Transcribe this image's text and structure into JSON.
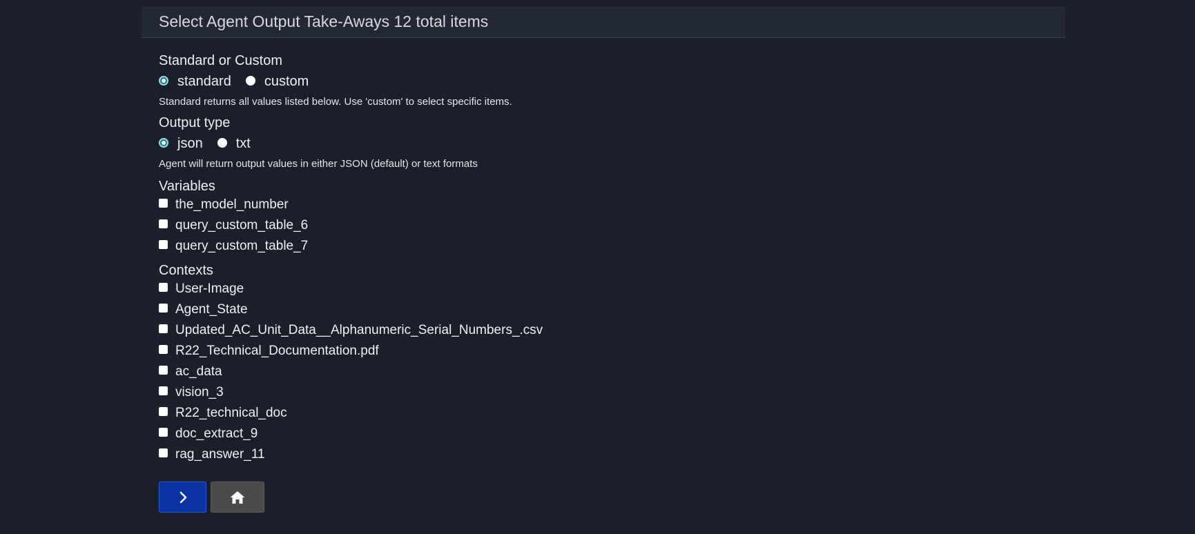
{
  "header": {
    "title": "Select Agent Output Take-Aways 12 total items"
  },
  "mode": {
    "label": "Standard or Custom",
    "options": [
      {
        "label": "standard",
        "checked": true
      },
      {
        "label": "custom",
        "checked": false
      }
    ],
    "help": "Standard returns all values listed below. Use 'custom' to select specific items."
  },
  "output_type": {
    "label": "Output type",
    "options": [
      {
        "label": "json",
        "checked": true
      },
      {
        "label": "txt",
        "checked": false
      }
    ],
    "help": "Agent will return output values in either JSON (default) or text formats"
  },
  "variables": {
    "label": "Variables",
    "items": [
      {
        "label": "the_model_number",
        "checked": false
      },
      {
        "label": "query_custom_table_6",
        "checked": false
      },
      {
        "label": "query_custom_table_7",
        "checked": false
      }
    ]
  },
  "contexts": {
    "label": "Contexts",
    "items": [
      {
        "label": "User-Image",
        "checked": false
      },
      {
        "label": "Agent_State",
        "checked": false
      },
      {
        "label": "Updated_AC_Unit_Data__Alphanumeric_Serial_Numbers_.csv",
        "checked": false
      },
      {
        "label": "R22_Technical_Documentation.pdf",
        "checked": false
      },
      {
        "label": "ac_data",
        "checked": false
      },
      {
        "label": "vision_3",
        "checked": false
      },
      {
        "label": "R22_technical_doc",
        "checked": false
      },
      {
        "label": "doc_extract_9",
        "checked": false
      },
      {
        "label": "rag_answer_11",
        "checked": false
      }
    ]
  },
  "buttons": {
    "next_icon": "chevron-right-icon",
    "home_icon": "home-icon"
  },
  "colors": {
    "background": "#1a1f2b",
    "header_background": "#222835",
    "next_button": "#0833a0",
    "home_button": "#4a4a4a",
    "radio_checked": "#0a7f8a"
  }
}
